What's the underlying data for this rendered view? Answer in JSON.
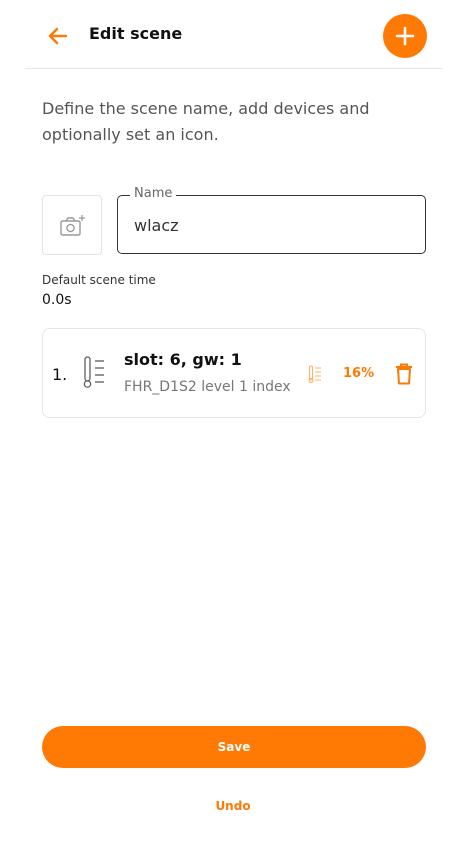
{
  "header": {
    "title": "Edit scene",
    "back_icon": "arrow-left-icon",
    "add_icon": "plus-icon"
  },
  "description": "Define the scene name, add devices and optionally set an icon.",
  "icon_picker": {
    "icon": "camera-add-icon"
  },
  "name_field": {
    "label": "Name",
    "value": "wlacz"
  },
  "scene_time": {
    "label": "Default scene time",
    "value": "0.0s"
  },
  "devices": [
    {
      "index": "1.",
      "icon": "thermometer-level-icon",
      "title": "slot: 6, gw: 1",
      "subtitle": "FHR_D1S2 level 1 index",
      "level_icon": "level-slider-icon",
      "percent": "16%",
      "delete_icon": "trash-icon"
    }
  ],
  "actions": {
    "save_label": "Save",
    "undo_label": "Undo"
  },
  "colors": {
    "accent": "#ff7a05",
    "text": "#1a1a1a",
    "muted": "#777777"
  }
}
